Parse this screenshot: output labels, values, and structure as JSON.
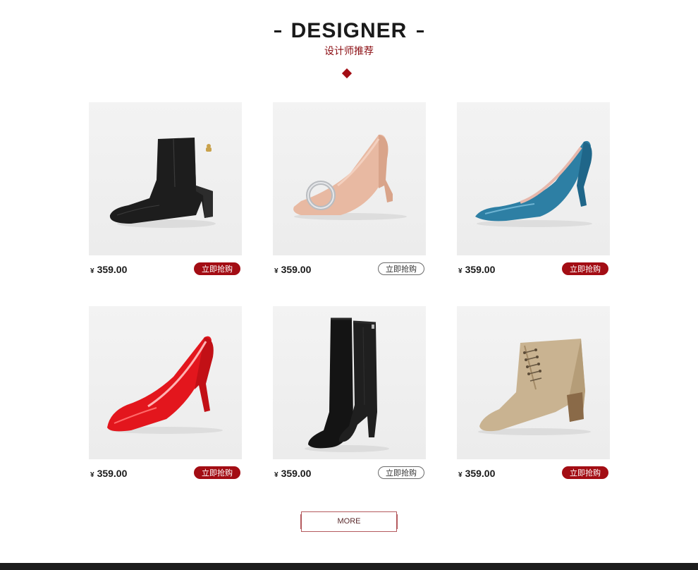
{
  "header": {
    "title": "DESIGNER",
    "subtitle": "设计师推荐"
  },
  "products": [
    {
      "image": "black-ankle-boot",
      "currency": "¥",
      "price": "359.00",
      "button_label": "立即抢购",
      "button_style": "filled"
    },
    {
      "image": "nude-pump-with-ring-buckle",
      "currency": "¥",
      "price": "359.00",
      "button_label": "立即抢购",
      "button_style": "outline"
    },
    {
      "image": "teal-patent-pump",
      "currency": "¥",
      "price": "359.00",
      "button_label": "立即抢购",
      "button_style": "filled"
    },
    {
      "image": "red-patent-pump",
      "currency": "¥",
      "price": "359.00",
      "button_label": "立即抢购",
      "button_style": "filled"
    },
    {
      "image": "black-suede-knee-boot",
      "currency": "¥",
      "price": "359.00",
      "button_label": "立即抢购",
      "button_style": "outline"
    },
    {
      "image": "beige-lace-up-ankle-boot",
      "currency": "¥",
      "price": "359.00",
      "button_label": "立即抢购",
      "button_style": "filled"
    }
  ],
  "more": {
    "label": "MORE"
  },
  "colors": {
    "accent": "#a30d14",
    "text": "#1a1a1a",
    "subtitle": "#8b0d12"
  }
}
